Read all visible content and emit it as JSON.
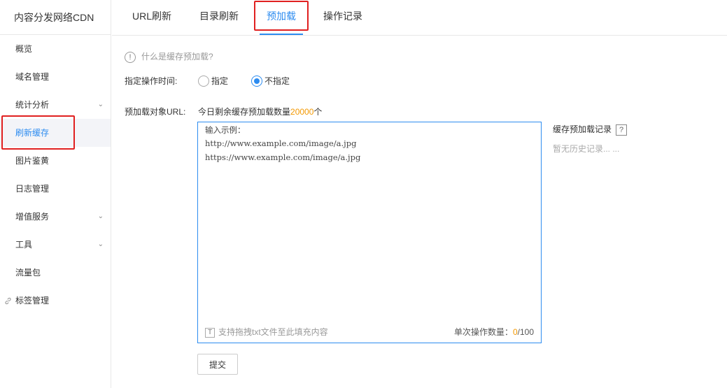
{
  "sidebar": {
    "title": "内容分发网络CDN",
    "items": [
      {
        "label": "概览"
      },
      {
        "label": "域名管理"
      },
      {
        "label": "统计分析",
        "chevron": "⌄"
      },
      {
        "label": "刷新缓存"
      },
      {
        "label": "图片鉴黄"
      },
      {
        "label": "日志管理"
      },
      {
        "label": "增值服务",
        "chevron": "⌄"
      },
      {
        "label": "工具",
        "chevron": "⌄"
      },
      {
        "label": "流量包"
      },
      {
        "label": "标签管理",
        "icon": "🔗"
      }
    ]
  },
  "tabs": [
    {
      "label": "URL刷新"
    },
    {
      "label": "目录刷新"
    },
    {
      "label": "预加载"
    },
    {
      "label": "操作记录"
    }
  ],
  "help": {
    "icon": "!",
    "text": "什么是缓存预加载?"
  },
  "time": {
    "label": "指定操作时间:",
    "options": [
      {
        "label": "指定"
      },
      {
        "label": "不指定"
      }
    ]
  },
  "url": {
    "label": "预加载对象URL:",
    "quota_prefix": "今日剩余缓存预加载数量",
    "quota_value": "20000",
    "quota_suffix": "个",
    "textarea_lines": [
      "输入示例：",
      "http://www.example.com/image/a.jpg",
      "https://www.example.com/image/a.jpg"
    ],
    "drag_icon": "T",
    "drag_hint": "支持拖拽txt文件至此填充内容",
    "count_label": "单次操作数量：",
    "count_value": "0",
    "count_max": "/100"
  },
  "history": {
    "title": "缓存预加载记录",
    "help_icon": "?",
    "empty": "暂无历史记录... ..."
  },
  "submit_label": "提交",
  "colors": {
    "accent": "#2d8cf0",
    "orange": "#f39800",
    "highlight": "#e02020"
  }
}
